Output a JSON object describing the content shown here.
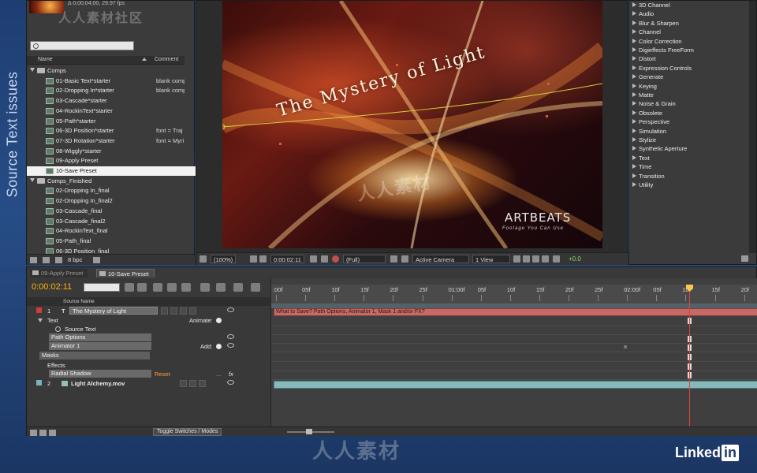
{
  "side_title": "Source Text issues",
  "project": {
    "info": "Δ 0;00;04;00, 29.97 fps",
    "watermark": "人人素材社区",
    "col_name": "Name",
    "col_comment": "Comment",
    "rows": [
      {
        "type": "folder",
        "name": "Comps",
        "comment": "",
        "indent": 0
      },
      {
        "type": "comp",
        "name": "01-Basic Text*starter",
        "comment": "blank comp",
        "indent": 1
      },
      {
        "type": "comp",
        "name": "02-Dropping In*starter",
        "comment": "blank comp",
        "indent": 1
      },
      {
        "type": "comp",
        "name": "03-Cascade*starter",
        "comment": "",
        "indent": 1
      },
      {
        "type": "comp",
        "name": "04-RockinText*starter",
        "comment": "",
        "indent": 1
      },
      {
        "type": "comp",
        "name": "05-Path*starter",
        "comment": "",
        "indent": 1
      },
      {
        "type": "comp",
        "name": "06-3D Position*starter",
        "comment": "font = Traj",
        "indent": 1
      },
      {
        "type": "comp",
        "name": "07-3D Rotation*starter",
        "comment": "font = Myri",
        "indent": 1
      },
      {
        "type": "comp",
        "name": "08-Wiggly*starter",
        "comment": "",
        "indent": 1
      },
      {
        "type": "comp",
        "name": "09-Apply Preset",
        "comment": "",
        "indent": 1
      },
      {
        "type": "comp",
        "name": "10-Save Preset",
        "comment": "",
        "indent": 1,
        "selected": true
      },
      {
        "type": "folder",
        "name": "Comps_Finished",
        "comment": "",
        "indent": 0
      },
      {
        "type": "comp",
        "name": "02-Dropping In_final",
        "comment": "",
        "indent": 1
      },
      {
        "type": "comp",
        "name": "02-Dropping In_final2",
        "comment": "",
        "indent": 1
      },
      {
        "type": "comp",
        "name": "03-Cascade_final",
        "comment": "",
        "indent": 1
      },
      {
        "type": "comp",
        "name": "03-Cascade_final2",
        "comment": "",
        "indent": 1
      },
      {
        "type": "comp",
        "name": "04-RockinText_final",
        "comment": "",
        "indent": 1
      },
      {
        "type": "comp",
        "name": "05-Path_final",
        "comment": "",
        "indent": 1
      },
      {
        "type": "comp",
        "name": "06-3D Position_final",
        "comment": "",
        "indent": 1
      }
    ],
    "bpc": "8 bpc"
  },
  "viewer": {
    "title_text": "The Mystery of Light",
    "brand": "ARTBEATS",
    "brand_tag": "Footage You Can Use",
    "watermark": "人人素材",
    "zoom": "(100%)",
    "time": "0:00:02:11",
    "resolution": "(Full)",
    "camera": "Active Camera",
    "view": "1 View",
    "exposure": "+0.0"
  },
  "effects": {
    "items": [
      "3D Channel",
      "Audio",
      "Blur & Sharpen",
      "Channel",
      "Color Correction",
      "Digieffects FreeForm",
      "Distort",
      "Expression Controls",
      "Generate",
      "Keying",
      "Matte",
      "Noise & Grain",
      "Obsolete",
      "Perspective",
      "Simulation",
      "Stylize",
      "Synthetic Aperture",
      "Text",
      "Time",
      "Transition",
      "Utility"
    ]
  },
  "timeline": {
    "tabs": [
      "09-Apply Preset",
      "10-Save Preset"
    ],
    "timecode": "0:00:02:11",
    "col_source": "Source Name",
    "ruler": [
      ":00f",
      "05f",
      "10f",
      "15f",
      "20f",
      "25f",
      "01:00f",
      "05f",
      "10f",
      "15f",
      "20f",
      "25f",
      "02:00f",
      "05f",
      "10f",
      "15f",
      "20f"
    ],
    "layer1_num": "1",
    "layer1_name": "The Mystery of Light",
    "text_group": "Text",
    "animate_label": "Animate:",
    "source_text": "Source Text",
    "path_options": "Path Options",
    "animator": "Animator 1",
    "add_label": "Add:",
    "masks": "Masks",
    "effects_group": "Effects",
    "radial_shadow": "Radial Shadow",
    "reset": "Reset",
    "dots": "...",
    "layer2_num": "2",
    "layer2_name": "Light Alchemy.mov",
    "bar_comment": "What to Save? Path Options, Animator 1, Mask 1 and/or FX?",
    "toggle_switches": "Toggle Switches / Modes"
  },
  "watermark_bottom": "人人素材",
  "brand": {
    "text": "Linked",
    "in": "in"
  }
}
